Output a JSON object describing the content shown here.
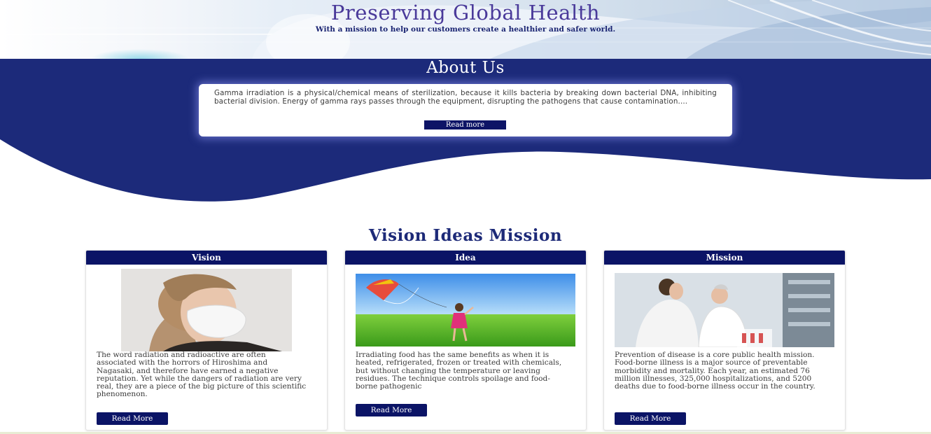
{
  "hero": {
    "title": "Preserving Global Health",
    "subtitle": "With a mission to help our customers create a healthier and safer world."
  },
  "about": {
    "title": "About Us",
    "text": "Gamma irradiation is a physical/chemical means of sterilization, because it kills bacteria by breaking down bacterial DNA, inhibiting bacterial division. Energy of gamma rays passes through the equipment, disrupting the pathogens that cause contamination....",
    "button_label": "Read more"
  },
  "vim": {
    "title": "Vision Ideas Mission",
    "cards": [
      {
        "heading": "Vision",
        "text": "The word radiation and radioactive are often associated with the horrors of Hiroshima and Nagasaki, and therefore have earned a negative reputation. Yet while the dangers of radiation are very real, they are a piece of the big picture of this scientific phenomenon.",
        "button_label": "Read More"
      },
      {
        "heading": "Idea",
        "text": "Irradiating food has the same benefits as when it is heated, refrigerated, frozen or treated with chemicals, but without changing the temperature or leaving residues. The technique controls spoilage and food-borne pathogenic",
        "button_label": "Read More"
      },
      {
        "heading": "Mission",
        "text": "Prevention of disease is a core public health mission. Food-borne illness is a major source of preventable morbidity and mortality. Each year, an estimated 76 million illnesses, 325,000 hospitalizations, and 5200 deaths due to food-borne illness occur in the country.",
        "button_label": "Read More"
      }
    ]
  },
  "colors": {
    "navy": "#1c2a7a",
    "button": "#0b1466",
    "title_purple": "#4a3a9a"
  }
}
